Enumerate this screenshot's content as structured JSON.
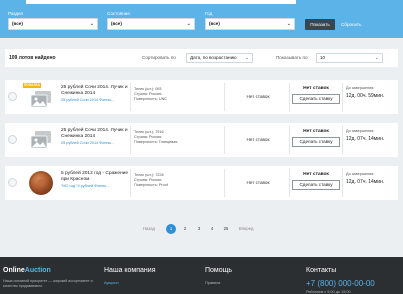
{
  "filters": {
    "section": {
      "label": "Раздел",
      "value": "(все)"
    },
    "condition": {
      "label": "Состояние",
      "value": "(все)"
    },
    "year": {
      "label": "Год",
      "value": "(все)"
    },
    "show_button": "Показать",
    "reset_link": "Сбросить"
  },
  "sort_bar": {
    "lots_found": "109 лотов найдено",
    "sort_label": "Сортировать по",
    "sort_value": "Дата, по возрастанию",
    "per_page_label": "Показывать по",
    "per_page_value": "10"
  },
  "lots": [
    {
      "badge": "ПОКАЗКА",
      "thumb": "placeholder-photo-icon",
      "title": "25 рублей Сочи 2014. Лучик и Снежинка 2014",
      "category": "25 рублей Сочи 2014 Фонны...",
      "props": {
        "lot": "Телек (шт.): 093",
        "country": "Страна: Россия",
        "surface": "Поверхность: UNC"
      },
      "current_bid": "Нет ставок",
      "bids_title": "Нет ставок",
      "bid_button": "Сделать ставку",
      "end_label": "До завершения:",
      "end_value": "12д. 00ч. 59мин."
    },
    {
      "badge": "",
      "thumb": "placeholder-photo-icon",
      "title": "25 рублей Сочи 2014. Лучик и Снежинка 2014",
      "category": "25 рублей Сочи 2014 Фонны...",
      "props": {
        "lot": "Телек (шт.): 7916",
        "country": "Страна: Россия",
        "surface": "Поверхность: Глянцевая"
      },
      "current_bid": "Нет ставок",
      "bids_title": "Нет ставок",
      "bid_button": "Сделать ставку",
      "end_label": "До завершения:",
      "end_value": "12д. 07ч. 14мин."
    },
    {
      "badge": "",
      "thumb": "coin-photo",
      "title": "5 рублей 2012 год - Сражение при Красном",
      "category": "\"МО год\" 5 рублей Фонны...",
      "props": {
        "lot": "Телек (шт.): 7228",
        "country": "Страна: Россия",
        "surface": "Поверхность: Proof"
      },
      "current_bid": "Нет ставок",
      "bids_title": "Нет ставок",
      "bid_button": "Сделать ставку",
      "end_label": "До завершения:",
      "end_value": "12д. 07ч. 14мин."
    }
  ],
  "pagination": {
    "prev": "Назад",
    "pages": [
      "1",
      "2",
      "3",
      "4",
      "25"
    ],
    "active": "1",
    "next": "Вперед"
  },
  "footer": {
    "logo_main": "Online",
    "logo_accent": "Auction",
    "tagline": "Наша основной приоритет — широкий ассортимент и качество продаваемого",
    "company_heading": "Наша компания",
    "company_link": "Аукцион",
    "help_heading": "Помощь",
    "help_link": "Правила",
    "contacts_heading": "Контакты",
    "phone": "+7 (800) 000-00-00",
    "contacts_line": "Работаем с 9:00 до 19:00"
  },
  "colors": {
    "accent": "#5bb3e8",
    "link": "#2e8fd6",
    "footer_bg": "#2b2f31",
    "badge": "#f6b21b",
    "button_dark": "#37474f"
  }
}
